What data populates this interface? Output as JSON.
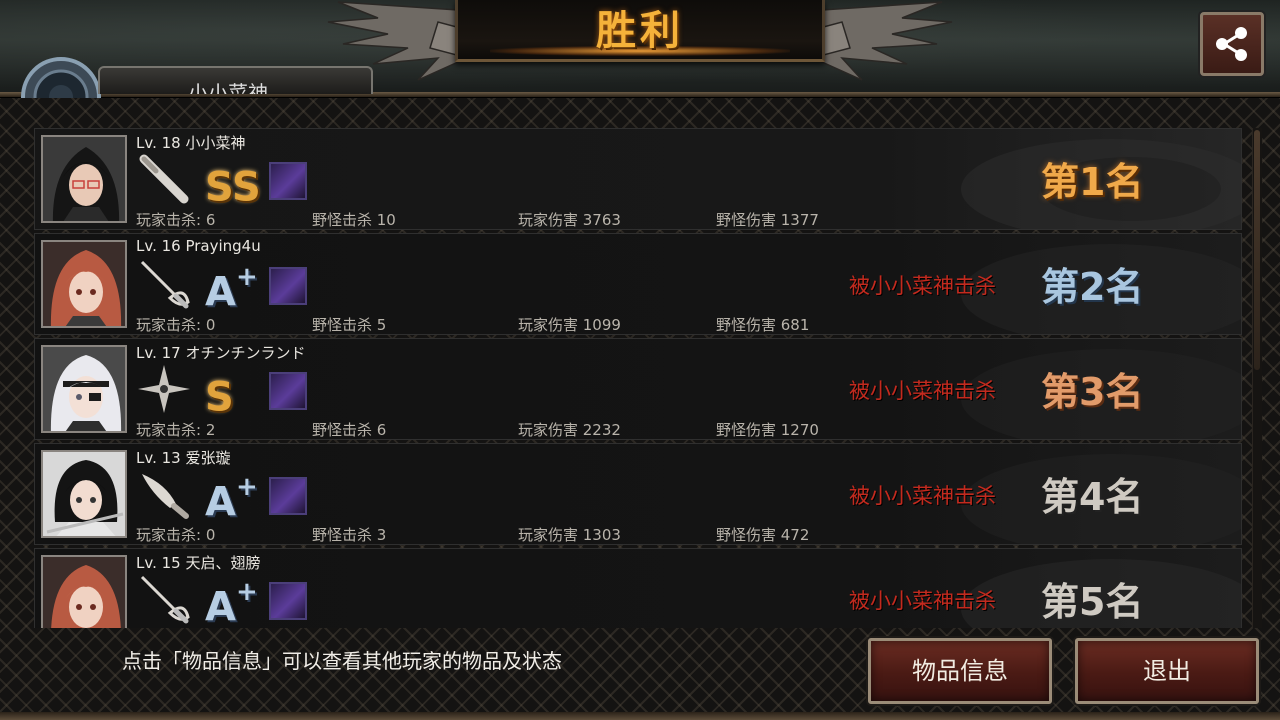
{
  "title": "胜利",
  "header": {
    "player_name_partial": "小小菜神"
  },
  "rows": [
    {
      "level": "Lv. 18 小小菜神",
      "grade": "SS",
      "grade_plus": "",
      "grade_color": "#e1a33c",
      "weapon_icon": "baseball-bat-icon",
      "player_kills": "玩家击杀: 6",
      "monster_kills": "野怪击杀 10",
      "player_damage": "玩家伤害 3763",
      "monster_damage": "野怪伤害 1377",
      "killed_by": "",
      "rank": "第1名"
    },
    {
      "level": "Lv. 16 Praying4u",
      "grade": "A",
      "grade_plus": "+",
      "grade_color": "#b6cde3",
      "weapon_icon": "rapier-icon",
      "player_kills": "玩家击杀: 0",
      "monster_kills": "野怪击杀 5",
      "player_damage": "玩家伤害 1099",
      "monster_damage": "野怪伤害 681",
      "killed_by": "被小小菜神击杀",
      "rank": "第2名"
    },
    {
      "level": "Lv. 17 オチンチンランド",
      "grade": "S",
      "grade_plus": "",
      "grade_color": "#e1a33c",
      "weapon_icon": "shuriken-icon",
      "player_kills": "玩家击杀: 2",
      "monster_kills": "野怪击杀 6",
      "player_damage": "玩家伤害 2232",
      "monster_damage": "野怪伤害 1270",
      "killed_by": "被小小菜神击杀",
      "rank": "第3名"
    },
    {
      "level": "Lv. 13 爱张璇",
      "grade": "A",
      "grade_plus": "+",
      "grade_color": "#b6cde3",
      "weapon_icon": "knife-icon",
      "player_kills": "玩家击杀: 0",
      "monster_kills": "野怪击杀 3",
      "player_damage": "玩家伤害 1303",
      "monster_damage": "野怪伤害 472",
      "killed_by": "被小小菜神击杀",
      "rank": "第4名"
    },
    {
      "level": "Lv. 15 天启、翅膀",
      "grade": "A",
      "grade_plus": "+",
      "grade_color": "#b6cde3",
      "weapon_icon": "rapier-icon",
      "player_kills": "",
      "monster_kills": "",
      "player_damage": "",
      "monster_damage": "",
      "killed_by": "被小小菜神击杀",
      "rank": "第5名"
    }
  ],
  "footer": {
    "hint": "点击「物品信息」可以查看其他玩家的物品及状态",
    "items_button": "物品信息",
    "exit_button": "退出"
  }
}
